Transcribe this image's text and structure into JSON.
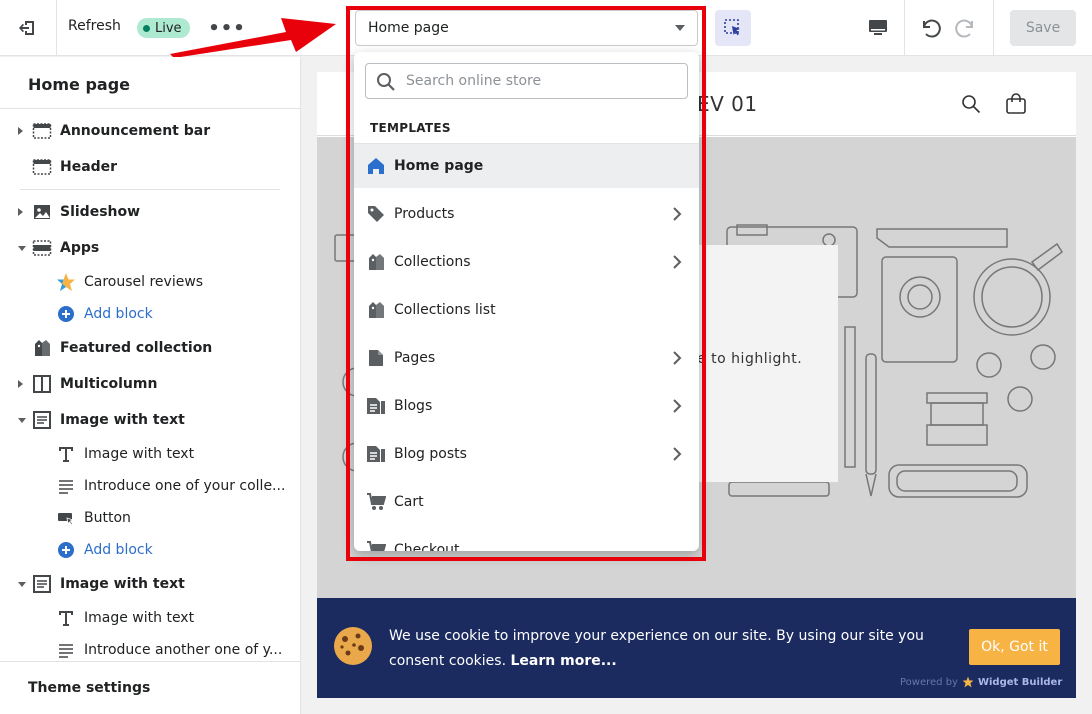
{
  "topbar": {
    "refresh_label": "Refresh",
    "live_label": "Live",
    "more_label": "•••",
    "page_select_value": "Home page",
    "save_label": "Save"
  },
  "sidebar": {
    "title": "Home page",
    "items": [
      {
        "label": "Announcement bar",
        "icon": "section-icon",
        "expand": "collapsed"
      },
      {
        "label": "Header",
        "icon": "section-icon",
        "expand": "none"
      },
      {
        "label": "Slideshow",
        "icon": "image-icon",
        "expand": "collapsed"
      },
      {
        "label": "Apps",
        "icon": "section-icon",
        "expand": "expanded"
      },
      {
        "label": "Carousel reviews",
        "icon": "app-star-icon",
        "sub": true
      },
      {
        "label": "Add block",
        "icon": "add-circle-icon",
        "sub": true,
        "add": true
      },
      {
        "label": "Featured collection",
        "icon": "collection-tag-icon",
        "expand": "none"
      },
      {
        "label": "Multicolumn",
        "icon": "columns-icon",
        "expand": "collapsed"
      },
      {
        "label": "Image with text",
        "icon": "image-text-icon",
        "expand": "expanded"
      },
      {
        "label": "Image with text",
        "icon": "text-t-icon",
        "sub": true
      },
      {
        "label": "Introduce one of your colle...",
        "icon": "paragraph-icon",
        "sub": true
      },
      {
        "label": "Button",
        "icon": "button-icon",
        "sub": true
      },
      {
        "label": "Add block",
        "icon": "add-circle-icon",
        "sub": true,
        "add": true
      },
      {
        "label": "Image with text",
        "icon": "image-text-icon",
        "expand": "expanded"
      },
      {
        "label": "Image with text",
        "icon": "text-t-icon",
        "sub": true
      },
      {
        "label": "Introduce another one of y...",
        "icon": "paragraph-icon",
        "sub": true
      }
    ],
    "footer_label": "Theme settings"
  },
  "dropdown": {
    "search_placeholder": "Search online store",
    "heading": "TEMPLATES",
    "items": [
      {
        "label": "Home page",
        "icon": "home-icon",
        "active": true,
        "chevron": false
      },
      {
        "label": "Products",
        "icon": "tag-icon",
        "chevron": true
      },
      {
        "label": "Collections",
        "icon": "collection-tag-icon",
        "chevron": true
      },
      {
        "label": "Collections list",
        "icon": "collection-tag-icon",
        "chevron": false
      },
      {
        "label": "Pages",
        "icon": "page-icon",
        "chevron": true
      },
      {
        "label": "Blogs",
        "icon": "blog-icon",
        "chevron": true
      },
      {
        "label": "Blog posts",
        "icon": "blog-icon",
        "chevron": true
      },
      {
        "label": "Cart",
        "icon": "cart-icon",
        "chevron": false
      },
      {
        "label": "Checkout",
        "icon": "cart-icon",
        "chevron": false
      }
    ]
  },
  "preview": {
    "store_name_fragment": "EV 01",
    "hero_text_fragment": "ke to highlight.",
    "cookie": {
      "text": "We use cookie to improve your experience on our site. By using our site you consent cookies.",
      "link": "Learn more...",
      "button": "Ok, Got it",
      "powered_by": "Powered by",
      "brand": "Widget Builder"
    }
  },
  "colors": {
    "accent_blue": "#2c6ecb",
    "live_badge": "#aee9d1",
    "highlight_red": "#e8000b",
    "cookie_bar": "#1b2a5f",
    "cookie_button": "#f7b445"
  }
}
